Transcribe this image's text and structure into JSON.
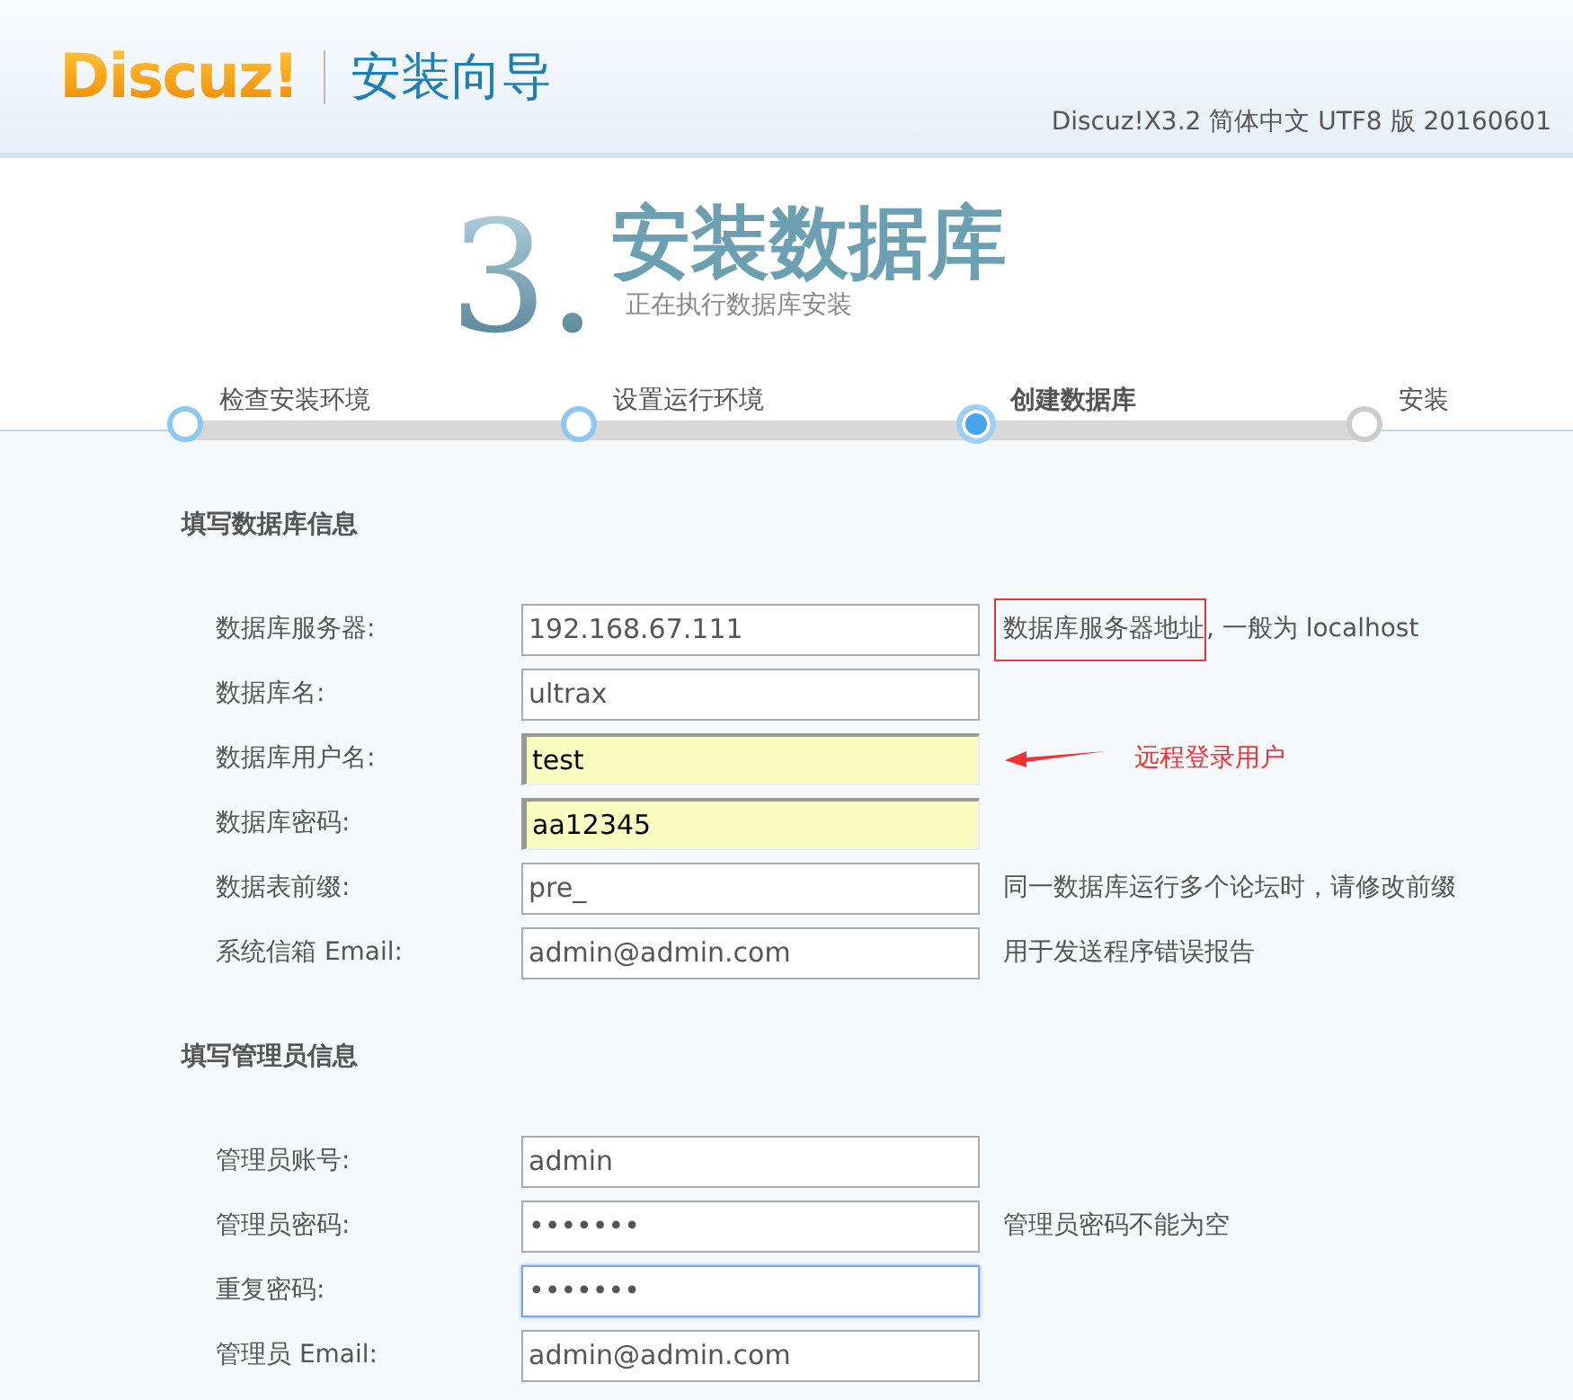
{
  "header": {
    "logo": "Discuz!",
    "title": "安装向导",
    "version": "Discuz!X3.2 简体中文 UTF8 版 20160601"
  },
  "step": {
    "number": "3.",
    "title": "安装数据库",
    "subtitle": "正在执行数据库安装"
  },
  "stages": [
    {
      "label": "检查安装环境",
      "done": true,
      "selected": false
    },
    {
      "label": "设置运行环境",
      "done": true,
      "selected": false
    },
    {
      "label": "创建数据库",
      "done": false,
      "selected": true
    },
    {
      "label": "安装",
      "done": false,
      "selected": false
    }
  ],
  "sections": [
    {
      "heading": "填写数据库信息",
      "rows": [
        {
          "label": "数据库服务器:",
          "value": "192.168.67.111",
          "autofilled": false,
          "focused": false,
          "hint_boxed": "数据库服务器地址",
          "hint": ", 一般为 localhost"
        },
        {
          "label": "数据库名:",
          "value": "ultrax",
          "autofilled": false,
          "focused": false
        },
        {
          "label": "数据库用户名:",
          "value": "test",
          "autofilled": true,
          "focused": false,
          "note": "远程登录用户"
        },
        {
          "label": "数据库密码:",
          "value": "aa12345",
          "autofilled": true,
          "focused": false
        },
        {
          "label": "数据表前缀:",
          "value": "pre_",
          "autofilled": false,
          "focused": false,
          "hint": "同一数据库运行多个论坛时，请修改前缀"
        },
        {
          "label": "系统信箱 Email:",
          "value": "admin@admin.com",
          "autofilled": false,
          "focused": false,
          "hint": "用于发送程序错误报告"
        }
      ]
    },
    {
      "heading": "填写管理员信息",
      "rows": [
        {
          "label": "管理员账号:",
          "value": "admin",
          "autofilled": false,
          "focused": false
        },
        {
          "label": "管理员密码:",
          "value": "•••••••",
          "autofilled": false,
          "focused": false,
          "hint": "管理员密码不能为空"
        },
        {
          "label": "重复密码:",
          "value": "•••••••",
          "autofilled": false,
          "focused": true
        },
        {
          "label": "管理员 Email:",
          "value": "admin@admin.com",
          "autofilled": false,
          "focused": false
        }
      ]
    }
  ]
}
